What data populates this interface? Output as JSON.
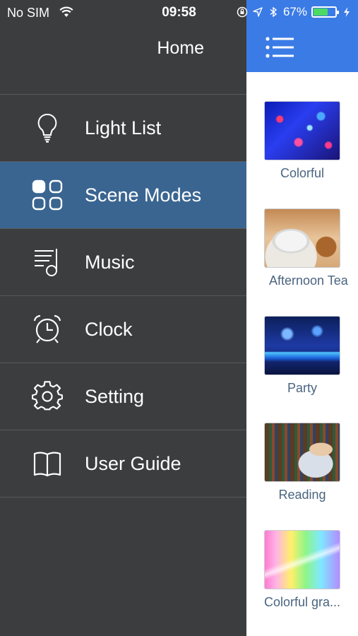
{
  "status_bar": {
    "carrier": "No SIM",
    "time": "09:58",
    "battery": "67%",
    "battery_level": 0.67,
    "icons": [
      "wifi-icon",
      "orientation-lock-icon",
      "location-icon",
      "bluetooth-icon",
      "charging-icon"
    ]
  },
  "drawer": {
    "title": "Home",
    "items": [
      {
        "label": "Light List",
        "icon": "lightbulb-icon"
      },
      {
        "label": "Scene Modes",
        "icon": "grid-icon"
      },
      {
        "label": "Music",
        "icon": "music-list-icon"
      },
      {
        "label": "Clock",
        "icon": "alarm-clock-icon"
      },
      {
        "label": "Setting",
        "icon": "gear-icon"
      },
      {
        "label": "User Guide",
        "icon": "book-icon"
      }
    ],
    "active_item": "Scene Modes"
  },
  "content": {
    "menu_icon": "hamburger-icon",
    "scenes": [
      {
        "label": "Colorful"
      },
      {
        "label": "Afternoon Tea"
      },
      {
        "label": "Party"
      },
      {
        "label": "Reading"
      },
      {
        "label": "Colorful gra..."
      }
    ]
  },
  "colors": {
    "drawer_bg": "#3c3d3f",
    "active_bg": "#3a6591",
    "accent_blue": "#3b7be6",
    "scene_label": "#4a6480",
    "battery_green": "#4cd964"
  }
}
